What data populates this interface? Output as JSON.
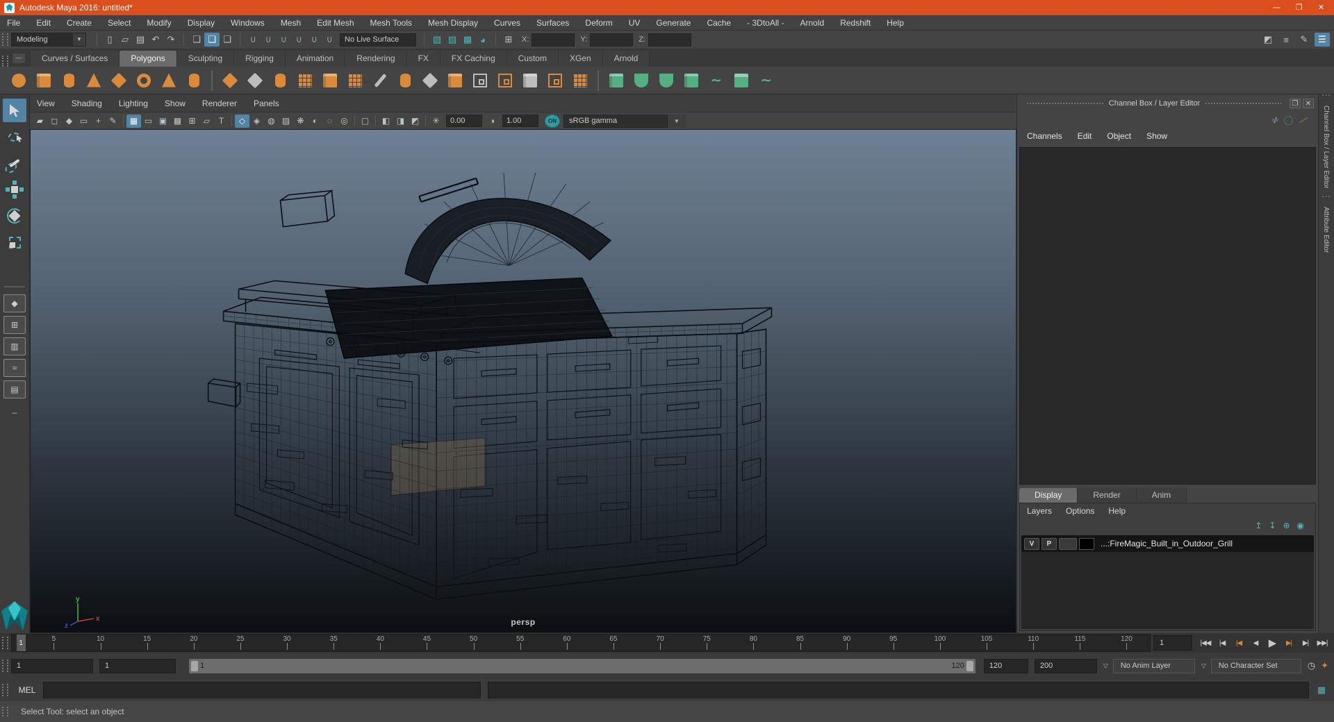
{
  "window": {
    "title": "Autodesk Maya 2016: untitled*",
    "controls": [
      {
        "name": "minimize-button",
        "glyph": "—"
      },
      {
        "name": "maximize-button",
        "glyph": "❐"
      },
      {
        "name": "close-button",
        "glyph": "✕"
      }
    ]
  },
  "menubar": {
    "items": [
      "File",
      "Edit",
      "Create",
      "Select",
      "Modify",
      "Display",
      "Windows",
      "Mesh",
      "Edit Mesh",
      "Mesh Tools",
      "Mesh Display",
      "Curves",
      "Surfaces",
      "Deform",
      "UV",
      "Generate",
      "Cache",
      "- 3DtoAll -",
      "Arnold",
      "Redshift",
      "Help"
    ]
  },
  "statusline": {
    "mode_selector": "Modeling",
    "file_icons": [
      {
        "name": "new-scene-icon",
        "glyph": "▯"
      },
      {
        "name": "open-scene-icon",
        "glyph": "▱"
      },
      {
        "name": "save-scene-icon",
        "glyph": "▤"
      },
      {
        "name": "undo-icon",
        "glyph": "↶"
      },
      {
        "name": "redo-icon",
        "glyph": "↷"
      }
    ],
    "selection_icons": [
      {
        "name": "select-hierarchy-icon",
        "glyph": "❏",
        "active": false
      },
      {
        "name": "select-object-icon",
        "glyph": "❏",
        "active": true
      },
      {
        "name": "select-component-icon",
        "glyph": "❏",
        "active": false
      }
    ],
    "snap_icons": [
      {
        "name": "snap-to-grid-icon"
      },
      {
        "name": "snap-to-curve-icon"
      },
      {
        "name": "snap-to-point-icon"
      },
      {
        "name": "snap-to-projected-center-icon"
      },
      {
        "name": "snap-to-view-plane-icon"
      },
      {
        "name": "make-live-icon"
      }
    ],
    "live_surface": "No Live Surface",
    "render_icons": [
      {
        "name": "render-current-frame-icon",
        "glyph": "▧"
      },
      {
        "name": "ipr-render-icon",
        "glyph": "▨"
      },
      {
        "name": "render-settings-icon",
        "glyph": "▩"
      },
      {
        "name": "render-view-icon",
        "glyph": "◕"
      }
    ],
    "counts_icon_glyph": "⊞",
    "axis_labels": {
      "x": "X:",
      "y": "Y:",
      "z": "Z:"
    },
    "axis_values": {
      "x": "",
      "y": "",
      "z": ""
    },
    "sidebar_toggles": [
      {
        "name": "modeling-toolkit-icon",
        "glyph": "◩",
        "active": false
      },
      {
        "name": "attribute-editor-icon",
        "glyph": "≡",
        "active": false
      },
      {
        "name": "tool-settings-icon",
        "glyph": "✎",
        "active": false
      },
      {
        "name": "channel-box-toggle-icon",
        "glyph": "☰",
        "active": true
      }
    ]
  },
  "shelf": {
    "collapse_label": "—",
    "tabs": [
      {
        "label": "Curves / Surfaces",
        "active": false
      },
      {
        "label": "Polygons",
        "active": true
      },
      {
        "label": "Sculpting",
        "active": false
      },
      {
        "label": "Rigging",
        "active": false
      },
      {
        "label": "Animation",
        "active": false
      },
      {
        "label": "Rendering",
        "active": false
      },
      {
        "label": "FX",
        "active": false
      },
      {
        "label": "FX Caching",
        "active": false
      },
      {
        "label": "Custom",
        "active": false
      },
      {
        "label": "XGen",
        "active": false
      },
      {
        "label": "Arnold",
        "active": false
      }
    ],
    "icons": [
      {
        "name": "poly-sphere-icon",
        "shape": "circle",
        "color": "orange"
      },
      {
        "name": "poly-cube-icon",
        "shape": "cube",
        "color": "orange"
      },
      {
        "name": "poly-cylinder-icon",
        "shape": "cylinder",
        "color": "orange"
      },
      {
        "name": "poly-cone-icon",
        "shape": "cone",
        "color": "orange"
      },
      {
        "name": "poly-plane-icon",
        "shape": "diamond",
        "color": "orange"
      },
      {
        "name": "poly-torus-icon",
        "shape": "torus",
        "color": "orange"
      },
      {
        "name": "poly-pyramid-icon",
        "shape": "cone",
        "color": "orange"
      },
      {
        "name": "poly-pipe-icon",
        "shape": "cylinder",
        "color": "orange"
      },
      {
        "name": "separator"
      },
      {
        "name": "combine-icon",
        "shape": "diamond",
        "color": "orange"
      },
      {
        "name": "separate-icon",
        "shape": "diamond",
        "color": "gray"
      },
      {
        "name": "mirror-geometry-icon",
        "shape": "cylinder",
        "color": "orange"
      },
      {
        "name": "smooth-icon",
        "shape": "grid",
        "color": "orange"
      },
      {
        "name": "subdiv-proxy-icon",
        "shape": "cube",
        "color": "orange"
      },
      {
        "name": "reduce-icon",
        "shape": "grid",
        "color": "orange"
      },
      {
        "name": "crease-tool-icon",
        "shape": "knife",
        "color": "gray"
      },
      {
        "name": "extrude-icon",
        "shape": "cylinder",
        "color": "orange"
      },
      {
        "name": "smooth-mesh-preview-icon",
        "shape": "diamond",
        "color": "gray"
      },
      {
        "name": "bevel-icon",
        "shape": "cube",
        "color": "orange"
      },
      {
        "name": "edge-flow-icon",
        "shape": "frame",
        "color": "gray"
      },
      {
        "name": "insert-edge-loop-icon",
        "shape": "frame",
        "color": "orange"
      },
      {
        "name": "quad-draw-icon",
        "shape": "cube",
        "color": "gray"
      },
      {
        "name": "multi-cut-icon",
        "shape": "frame",
        "color": "orange"
      },
      {
        "name": "target-weld-icon",
        "shape": "grid",
        "color": "orange"
      },
      {
        "name": "separator"
      },
      {
        "name": "boolean-union-icon",
        "shape": "cube",
        "color": "green"
      },
      {
        "name": "boolean-difference-icon",
        "shape": "scoop",
        "color": "green"
      },
      {
        "name": "boolean-intersection-icon",
        "shape": "scoop",
        "color": "green"
      },
      {
        "name": "remesh-icon",
        "shape": "cube",
        "color": "green"
      },
      {
        "name": "curve-warp-icon",
        "shape": "squiggle",
        "color": "green"
      },
      {
        "name": "uv-editor-icon",
        "shape": "window",
        "color": "green"
      },
      {
        "name": "spread-objects-icon",
        "shape": "squiggle",
        "color": "green"
      }
    ]
  },
  "panel": {
    "menus": [
      "View",
      "Shading",
      "Lighting",
      "Show",
      "Renderer",
      "Panels"
    ],
    "toolbar_icons": [
      {
        "name": "select-camera-icon",
        "glyph": "▰"
      },
      {
        "name": "lock-camera-icon",
        "glyph": "◻"
      },
      {
        "name": "camera-bookmark-icon",
        "glyph": "◆"
      },
      {
        "name": "image-plane-icon",
        "glyph": "▭"
      },
      {
        "name": "2d-pan-zoom-icon",
        "glyph": "+"
      },
      {
        "name": "grease-pencil-icon",
        "glyph": "✎"
      },
      {
        "name": "separator"
      },
      {
        "name": "grid-icon",
        "glyph": "▦",
        "active": true
      },
      {
        "name": "film-gate-icon",
        "glyph": "▭"
      },
      {
        "name": "resolution-gate-icon",
        "glyph": "▣"
      },
      {
        "name": "gate-mask-icon",
        "glyph": "▩"
      },
      {
        "name": "field-chart-icon",
        "glyph": "⊞"
      },
      {
        "name": "safe-action-icon",
        "glyph": "▱"
      },
      {
        "name": "safe-title-icon",
        "glyph": "T"
      },
      {
        "name": "separator"
      },
      {
        "name": "wireframe-icon",
        "glyph": "◇",
        "active": true
      },
      {
        "name": "shaded-icon",
        "glyph": "◈"
      },
      {
        "name": "wireframe-on-shaded-icon",
        "glyph": "◍"
      },
      {
        "name": "textured-icon",
        "glyph": "▨"
      },
      {
        "name": "use-all-lights-icon",
        "glyph": "❋"
      },
      {
        "name": "shadows-icon",
        "glyph": "◐"
      },
      {
        "name": "occlusion-icon",
        "glyph": "◌"
      },
      {
        "name": "motion-blur-icon",
        "glyph": "◎"
      },
      {
        "name": "separator"
      },
      {
        "name": "isolate-select-icon",
        "glyph": "▢"
      },
      {
        "name": "separator"
      },
      {
        "name": "xray-icon",
        "glyph": "◧"
      },
      {
        "name": "xray-joints-icon",
        "glyph": "◨"
      },
      {
        "name": "xray-active-icon",
        "glyph": "◩"
      },
      {
        "name": "separator"
      },
      {
        "name": "exposure-icon",
        "glyph": "✳"
      }
    ],
    "exposure": "0.00",
    "contrast_icon_glyph": "◑",
    "contrast": "1.00",
    "gamma_on": "ON",
    "view_transform": "sRGB gamma",
    "dropdown_arrow": "▼"
  },
  "viewport": {
    "camera": "persp",
    "axes": {
      "x": "x",
      "y": "y",
      "z": "z"
    }
  },
  "channel_box": {
    "title": "Channel Box / Layer Editor",
    "float_glyph": "❐",
    "close_glyph": "✕",
    "menus": [
      "Channels",
      "Edit",
      "Object",
      "Show"
    ],
    "side_tabs": [
      "Channel Box / Layer Editor",
      "Attribute Editor"
    ]
  },
  "layer_editor": {
    "tabs": [
      {
        "label": "Display",
        "active": true
      },
      {
        "label": "Render",
        "active": false
      },
      {
        "label": "Anim",
        "active": false
      }
    ],
    "menus": [
      "Layers",
      "Options",
      "Help"
    ],
    "actions": [
      {
        "name": "move-layer-up-icon",
        "glyph": "↥"
      },
      {
        "name": "move-layer-down-icon",
        "glyph": "↧"
      },
      {
        "name": "add-empty-layer-icon",
        "glyph": "⊕"
      },
      {
        "name": "add-layer-from-selected-icon",
        "glyph": "◉"
      }
    ],
    "layers": [
      {
        "visibility": "V",
        "playback": "P",
        "name": "...:FireMagic_Built_in_Outdoor_Grill"
      }
    ]
  },
  "timeline": {
    "ticks": [
      5,
      10,
      15,
      20,
      25,
      30,
      35,
      40,
      45,
      50,
      55,
      60,
      65,
      70,
      75,
      80,
      85,
      90,
      95,
      100,
      105,
      110,
      115,
      120
    ],
    "axis_max": 122,
    "marker_frame": 1,
    "marker_label": "1",
    "current_frame": "1",
    "playback": [
      {
        "name": "go-to-start-button",
        "glyph": "|◀◀"
      },
      {
        "name": "step-back-frame-button",
        "glyph": "|◀"
      },
      {
        "name": "step-back-key-button",
        "glyph": "|◀",
        "accent": true
      },
      {
        "name": "play-backwards-button",
        "glyph": "◀"
      },
      {
        "name": "play-forwards-button",
        "glyph": "▶",
        "big": true
      },
      {
        "name": "step-forward-key-button",
        "glyph": "▶|",
        "accent": true
      },
      {
        "name": "step-forward-frame-button",
        "glyph": "▶|"
      },
      {
        "name": "go-to-end-button",
        "glyph": "▶▶|"
      }
    ]
  },
  "range_slider": {
    "animation_start": "1",
    "playback_start": "1",
    "bar_start_label": "1",
    "bar_end_label": "120",
    "playback_end": "120",
    "animation_end": "200",
    "anim_layer": "No Anim Layer",
    "character_set": "No Character Set",
    "icons": [
      {
        "name": "anim-preferences-icon",
        "glyph": "◷",
        "color": "#c8c8c8"
      },
      {
        "name": "auto-keyframe-icon",
        "glyph": "✦",
        "color": "#d1883a"
      }
    ]
  },
  "command_line": {
    "label": "MEL",
    "value": ""
  },
  "help_line": {
    "text": "Select Tool: select an object"
  }
}
